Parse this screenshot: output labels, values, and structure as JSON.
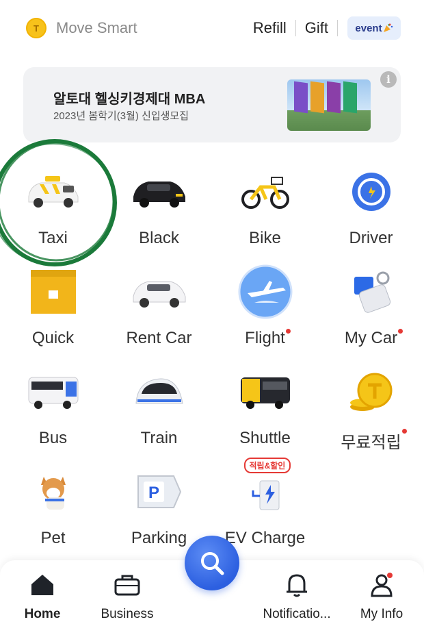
{
  "header": {
    "brand_icon_letter": "T",
    "brand": "Move Smart",
    "refill": "Refill",
    "gift": "Gift",
    "event": "event"
  },
  "banner": {
    "title": "알토대 헬싱키경제대 MBA",
    "subtitle": "2023년 봄학기(3월) 신입생모집",
    "info_glyph": "i"
  },
  "services": [
    {
      "label": "Taxi",
      "icon": "taxi-icon",
      "badge": false
    },
    {
      "label": "Black",
      "icon": "black-car-icon",
      "badge": false
    },
    {
      "label": "Bike",
      "icon": "bike-icon",
      "badge": false
    },
    {
      "label": "Driver",
      "icon": "steering-wheel-icon",
      "badge": false
    },
    {
      "label": "Quick",
      "icon": "package-icon",
      "badge": false
    },
    {
      "label": "Rent Car",
      "icon": "rent-car-icon",
      "badge": false
    },
    {
      "label": "Flight",
      "icon": "airplane-icon",
      "badge": true
    },
    {
      "label": "My Car",
      "icon": "car-key-icon",
      "badge": true
    },
    {
      "label": "Bus",
      "icon": "bus-icon",
      "badge": false
    },
    {
      "label": "Train",
      "icon": "train-icon",
      "badge": false
    },
    {
      "label": "Shuttle",
      "icon": "shuttle-icon",
      "badge": false
    },
    {
      "label": "무료적립",
      "icon": "coins-icon",
      "badge": true
    },
    {
      "label": "Pet",
      "icon": "dog-icon",
      "badge": false
    },
    {
      "label": "Parking",
      "icon": "parking-icon",
      "badge": false
    },
    {
      "label": "EV Charge",
      "icon": "ev-charger-icon",
      "badge": false,
      "tag": "적립&할인"
    }
  ],
  "bottom_nav": {
    "home": "Home",
    "business": "Business",
    "notifications": "Notificatio...",
    "my_info": "My Info"
  },
  "colors": {
    "accent_blue": "#2c5fe0",
    "taxi_yellow": "#f5c518",
    "circle_green": "#1b7a3a",
    "badge_red": "#e53935"
  }
}
